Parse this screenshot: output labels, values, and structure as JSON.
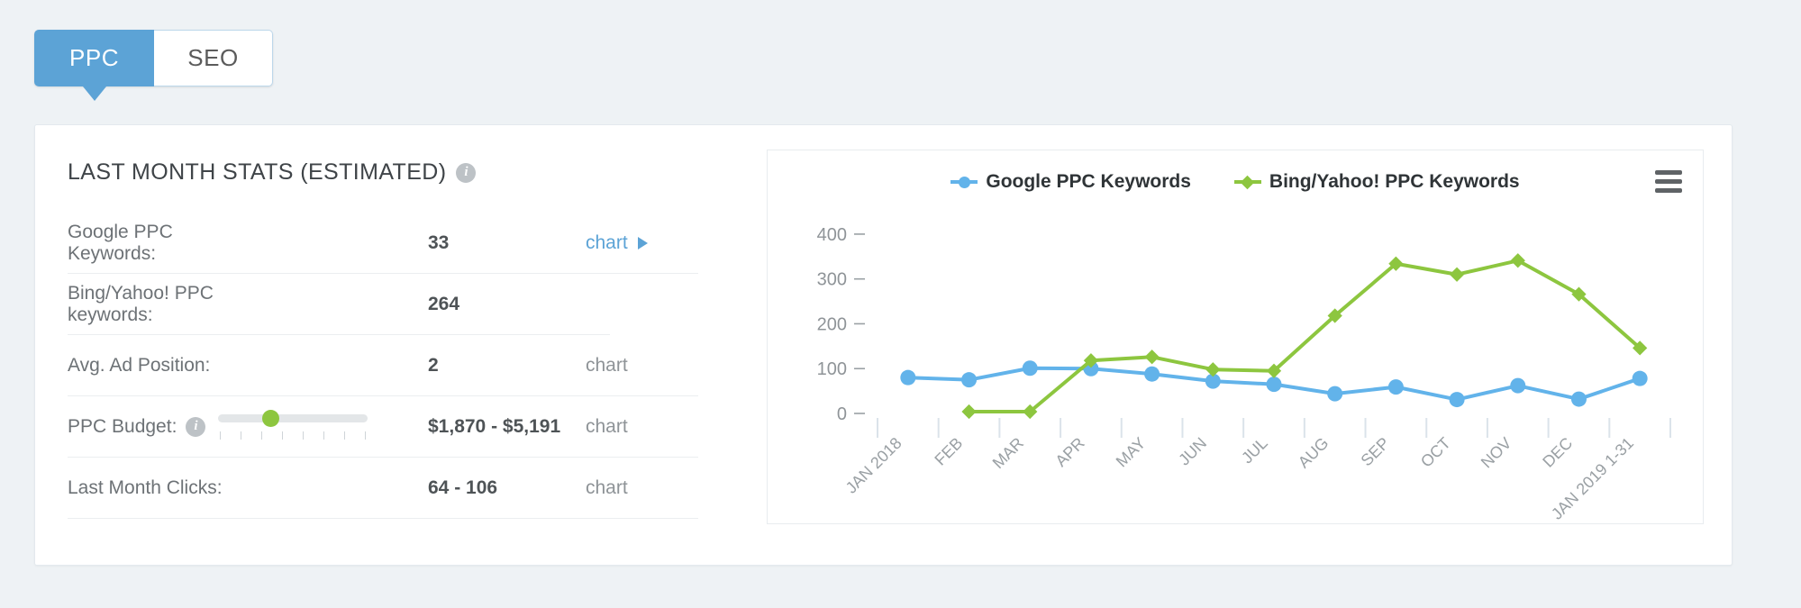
{
  "tabs": [
    {
      "label": "PPC",
      "active": true
    },
    {
      "label": "SEO",
      "active": false
    }
  ],
  "panel": {
    "title": "LAST MONTH STATS (ESTIMATED)",
    "info_icon": "info-icon",
    "rows": [
      {
        "label": "Google PPC Keywords:",
        "value": "33",
        "action": "chart",
        "action_arrow": "▶",
        "action_is_link": true
      },
      {
        "label": "Bing/Yahoo! PPC keywords:",
        "value": "264",
        "action": "",
        "action_arrow": "",
        "action_is_link": false
      },
      {
        "label": "Avg. Ad Position:",
        "value": "2",
        "action": "chart",
        "action_arrow": "",
        "action_is_link": false
      },
      {
        "label": "PPC Budget:",
        "value": "$1,870 - $5,191",
        "action": "chart",
        "action_arrow": "",
        "action_is_link": false
      },
      {
        "label": "Last Month Clicks:",
        "value": "64 - 106",
        "action": "chart",
        "action_arrow": "",
        "action_is_link": false
      }
    ],
    "budget_slider": {
      "name": "ppc-budget-slider",
      "position_percent": 33,
      "tick_count": 8,
      "thumb_color": "#8dc63f",
      "track_color": "#e3e6e8"
    }
  },
  "chart_menu": {
    "label": "chart-menu",
    "icon": "hamburger-menu-icon"
  },
  "colors": {
    "tab_active": "#5ca3d6",
    "link": "#5ca3d6",
    "google_series": "#62b3ea",
    "bing_series": "#8dc63f",
    "page_bg": "#eef2f5",
    "card_bg": "#ffffff"
  },
  "chart_data": {
    "type": "line",
    "title": "",
    "xlabel": "",
    "ylabel": "",
    "ylim": [
      0,
      430
    ],
    "yticks": [
      0,
      100,
      200,
      300,
      400
    ],
    "grid": false,
    "legend_position": "top-center",
    "categories": [
      "JAN 2018",
      "FEB",
      "MAR",
      "APR",
      "MAY",
      "JUN",
      "JUL",
      "AUG",
      "SEP",
      "OCT",
      "NOV",
      "DEC",
      "JAN 2019 1-31"
    ],
    "series": [
      {
        "name": "Google PPC Keywords",
        "color": "#62b3ea",
        "marker": "circle",
        "values": [
          80,
          75,
          101,
          100,
          88,
          72,
          65,
          44,
          59,
          31,
          62,
          32,
          78
        ]
      },
      {
        "name": "Bing/Yahoo! PPC Keywords",
        "color": "#8dc63f",
        "marker": "diamond",
        "values": [
          null,
          4,
          4,
          118,
          126,
          98,
          95,
          218,
          334,
          310,
          341,
          266,
          146
        ]
      }
    ]
  }
}
